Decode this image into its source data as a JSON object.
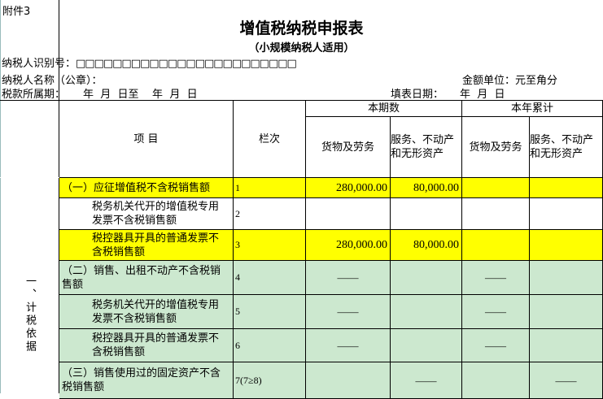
{
  "attachment": "附件3",
  "title": "增值税纳税申报表",
  "subtitle": "（小规模纳税人适用）",
  "taxpayer_id_label": "纳税人识别号：",
  "taxpayer_id_boxes": "□□□□□□□□□□□□□□□□□□□□□□□□",
  "taxpayer_name_label": "纳税人名称（公章）：",
  "amount_unit": "金额单位：元至角分",
  "period_label": "税款所属期：",
  "period_value": "年  月  日至    年  月  日",
  "fill_date_label": "填表日期：",
  "fill_date_value": "年  月  日",
  "header": {
    "item": "项  目",
    "column_no": "栏次",
    "current_period": "本期数",
    "year_total": "本年累计",
    "goods": "货物及劳务",
    "services": "服务、不动产和无形资产",
    "goods2": "货物及劳务",
    "services2": "服务、不动产和无形资产"
  },
  "section_label": "一、计税依据",
  "rows": [
    {
      "item": "（一）应征增值税不含税销售额",
      "no": "1",
      "cur_goods": "280,000.00",
      "cur_services": "80,000.00",
      "yr_goods": "",
      "yr_services": ""
    },
    {
      "item": "税务机关代开的增值税专用发票不含税销售额",
      "no": "2",
      "cur_goods": "",
      "cur_services": "",
      "yr_goods": "",
      "yr_services": ""
    },
    {
      "item": "税控器具开具的普通发票不含税销售额",
      "no": "3",
      "cur_goods": "280,000.00",
      "cur_services": "80,000.00",
      "yr_goods": "",
      "yr_services": ""
    },
    {
      "item": "（二）销售、出租不动产不含税销售额",
      "no": "4",
      "cur_goods": "——",
      "cur_services": "",
      "yr_goods": "——",
      "yr_services": ""
    },
    {
      "item": "税务机关代开的增值税专用发票不含税销售额",
      "no": "5",
      "cur_goods": "——",
      "cur_services": "",
      "yr_goods": "——",
      "yr_services": ""
    },
    {
      "item": "税控器具开具的普通发票不含税销售额",
      "no": "6",
      "cur_goods": "——",
      "cur_services": "",
      "yr_goods": "——",
      "yr_services": ""
    },
    {
      "item": "（三）销售使用过的固定资产不含税销售额",
      "no": "7(7≥8)",
      "cur_goods": "",
      "cur_services": "——",
      "yr_goods": "",
      "yr_services": "——"
    }
  ]
}
